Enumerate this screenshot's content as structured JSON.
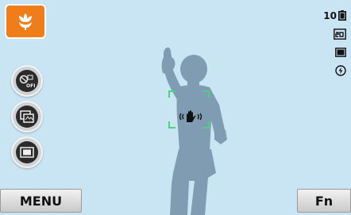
{
  "shooting_mode": {
    "icon": "flower-macro-icon",
    "color": "#ef7d1a"
  },
  "status": {
    "shots_remaining": "10",
    "battery_icon": "battery-icon",
    "resolution_icon": "resolution-20m-icon",
    "quality_icon": "image-quality-icon",
    "flash_icon": "flash-off-icon"
  },
  "side_buttons": [
    {
      "icon": "smart-filter-off-icon"
    },
    {
      "icon": "photo-style-icon"
    },
    {
      "icon": "display-mode-icon"
    }
  ],
  "viewfinder": {
    "focus_frame_color": "#4cd37a",
    "warning_icon": "camera-shake-icon"
  },
  "bottom_bar": {
    "menu_label": "MENU",
    "fn_label": "Fn"
  },
  "colors": {
    "sky": "#c9e4f3",
    "silhouette": "#7f9cb2"
  }
}
